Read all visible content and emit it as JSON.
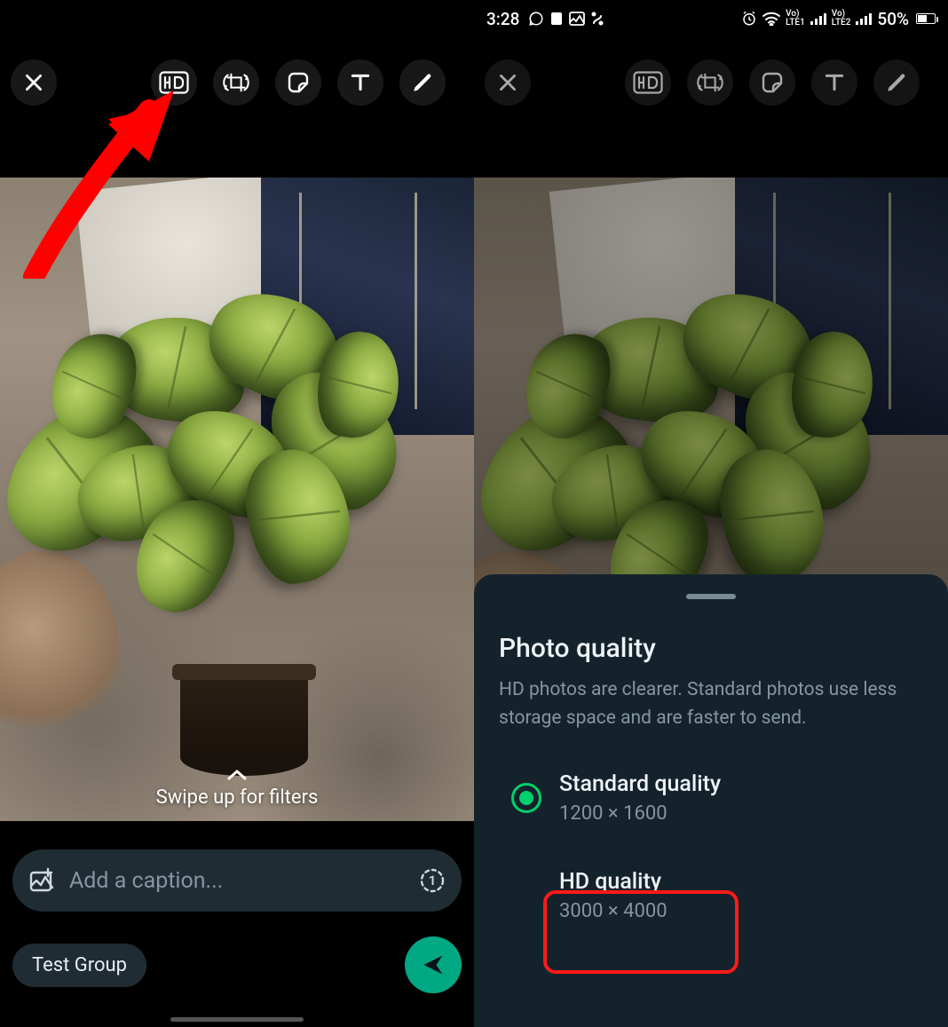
{
  "status": {
    "time": "3:28",
    "battery": "50%"
  },
  "left": {
    "swipe_hint": "Swipe up for filters",
    "caption_placeholder": "Add a caption...",
    "recipient_chip": "Test Group"
  },
  "right": {
    "sheet": {
      "title": "Photo quality",
      "description": "HD photos are clearer. Standard photos use less storage space and are faster to send.",
      "options": {
        "standard": {
          "label": "Standard quality",
          "resolution": "1200 × 1600"
        },
        "hd": {
          "label": "HD quality",
          "resolution": "3000 × 4000"
        }
      }
    }
  },
  "colors": {
    "accent_green": "#00a884",
    "radio_green": "#00d06c",
    "highlight_red": "#ff1a1a",
    "sheet_bg": "#14222b"
  }
}
